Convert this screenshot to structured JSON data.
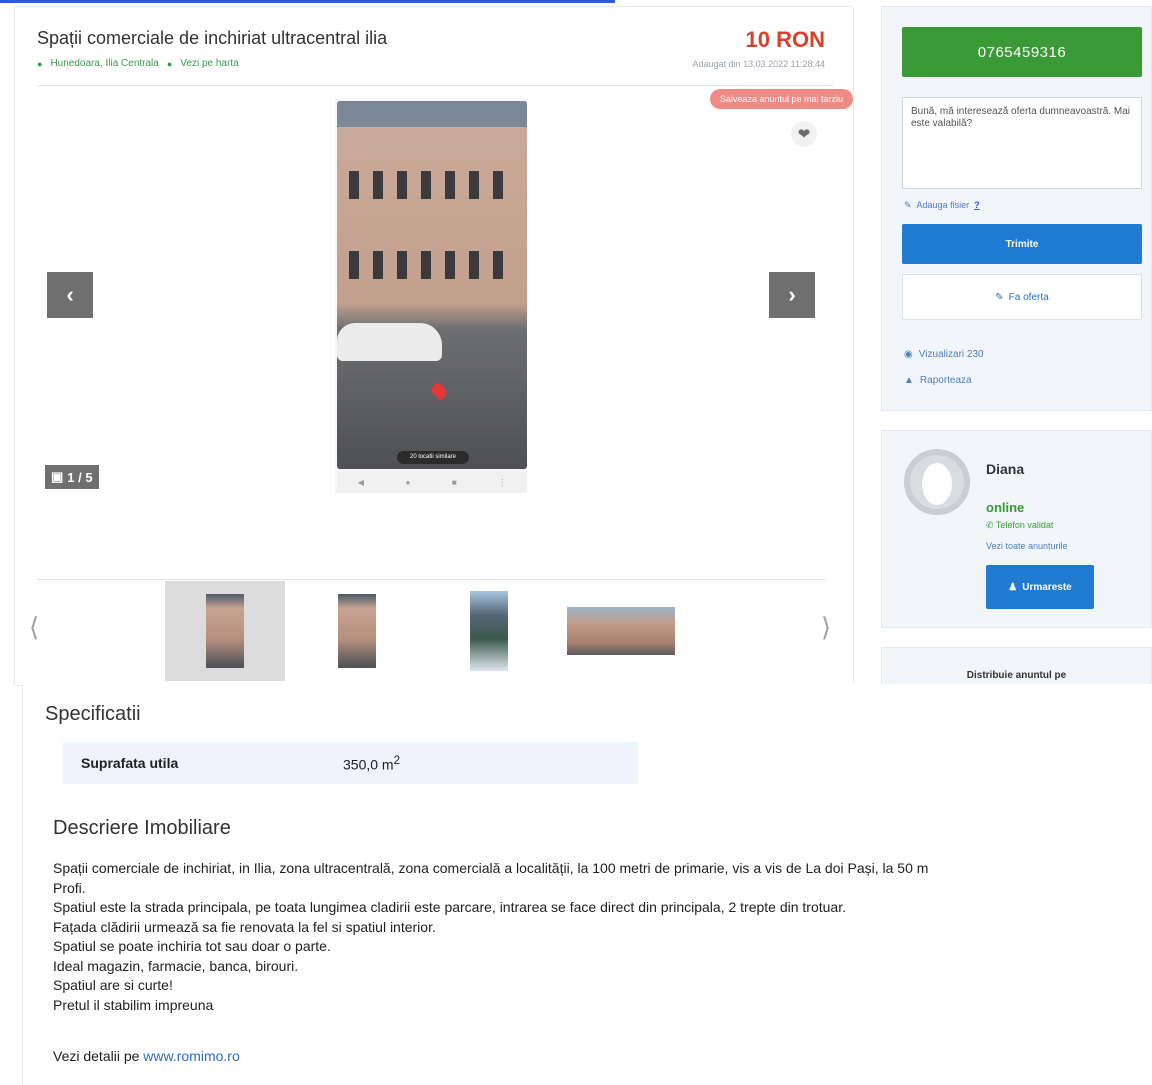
{
  "listing": {
    "title": "Spații comerciale de inchiriat ultracentral ilia",
    "location": "Hunedoara, Ilia Centrala",
    "map_link": "Vezi pe harta",
    "price": "10 RON",
    "date": "Adaugat din 13.03.2022 11:28:44",
    "save_label": "Salveaza anuntul pe mai tarziu",
    "photo_counter": "1 / 5",
    "phone_caption": "20 locatii similare",
    "thumbnails": [
      "thumb-1",
      "thumb-2",
      "thumb-3",
      "thumb-4"
    ]
  },
  "contact": {
    "phone": "0765459316",
    "message": "Bună, mă interesează oferta dumneavoastră. Mai este valabilă?",
    "attach_label": "Adauga fisier",
    "attach_help": "?",
    "send_label": "Trimite",
    "offer_label": "Fa oferta",
    "views_label": "Vizualizari 230",
    "report_label": "Raporteaza"
  },
  "seller": {
    "name": "Diana",
    "status": "online",
    "verified": "Telefon validat",
    "all_ads": "Vezi toate anunturile",
    "follow_label": "Urmareste"
  },
  "share": {
    "title": "Distribuie anuntul pe"
  },
  "specs": {
    "heading": "Specificatii",
    "rows": [
      {
        "label": "Suprafata utila",
        "value": "350,0 m",
        "unit_sup": "2"
      }
    ]
  },
  "description": {
    "heading": "Descriere Imobiliare",
    "lines": [
      "Spații comerciale de inchiriat, in Ilia, zona ultracentrală, zona comercială a localității, la 100 metri de primarie, vis a vis de La doi Pași, la 50 m",
      "Profi.",
      "Spatiul este la strada principala, pe toata lungimea cladirii este parcare, intrarea se face direct din principala, 2 trepte din trotuar.",
      "Fațada clădirii urmează sa fie renovata la fel si spatiul interior.",
      "Spatiul se poate inchiria tot sau doar o parte.",
      "Ideal magazin, farmacie, banca, birouri.",
      "Spatiul are si curte!",
      "Pretul il stabilim impreuna"
    ],
    "more_prefix": "Vezi detalii pe",
    "more_link": "www.romimo.ro"
  },
  "colors": {
    "price": "#d9412e",
    "phone_button": "#3a9a35",
    "primary_button": "#1e7bd1",
    "link": "#2a6fbf"
  }
}
